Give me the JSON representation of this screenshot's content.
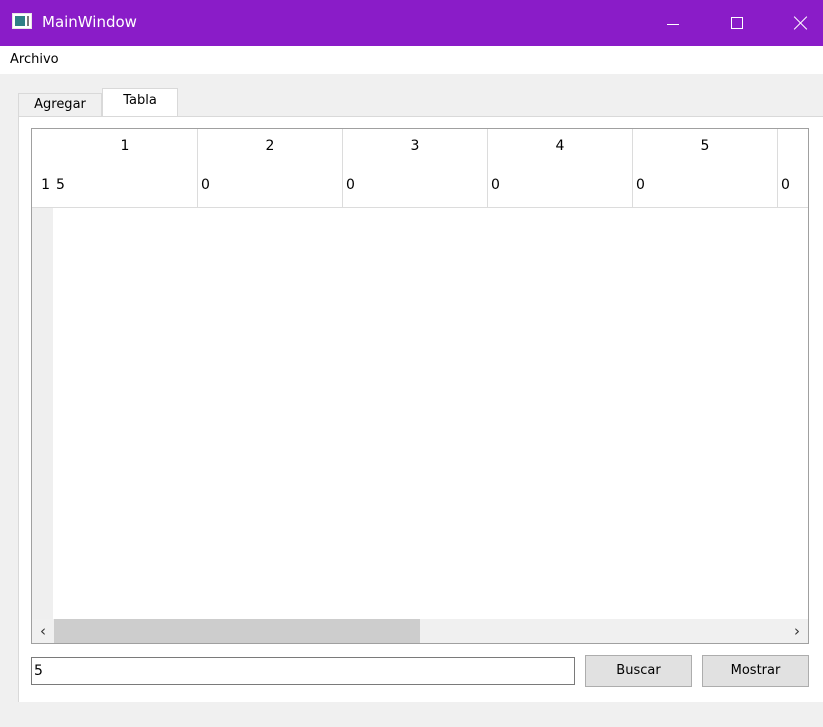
{
  "window": {
    "title": "MainWindow"
  },
  "menubar": {
    "items": [
      "Archivo"
    ]
  },
  "tabs": [
    {
      "label": "Agregar",
      "active": false
    },
    {
      "label": "Tabla",
      "active": true
    }
  ],
  "table": {
    "column_headers": [
      "1",
      "2",
      "3",
      "4",
      "5",
      ""
    ],
    "row_headers": [
      "1"
    ],
    "rows": [
      [
        "5",
        "0",
        "0",
        "0",
        "0",
        "0"
      ]
    ]
  },
  "search": {
    "value": "5"
  },
  "buttons": {
    "search_label": "Buscar",
    "show_label": "Mostrar"
  },
  "icons": {
    "app": "app-window-icon",
    "minimize": "minimize-icon",
    "maximize": "maximize-icon",
    "close": "close-icon",
    "scroll_left": "chevron-left-icon",
    "scroll_right": "chevron-right-icon"
  },
  "colors": {
    "titlebar": "#8a1cc8",
    "button": "#e1e1e1",
    "scroll_thumb": "#cdcdcd"
  }
}
